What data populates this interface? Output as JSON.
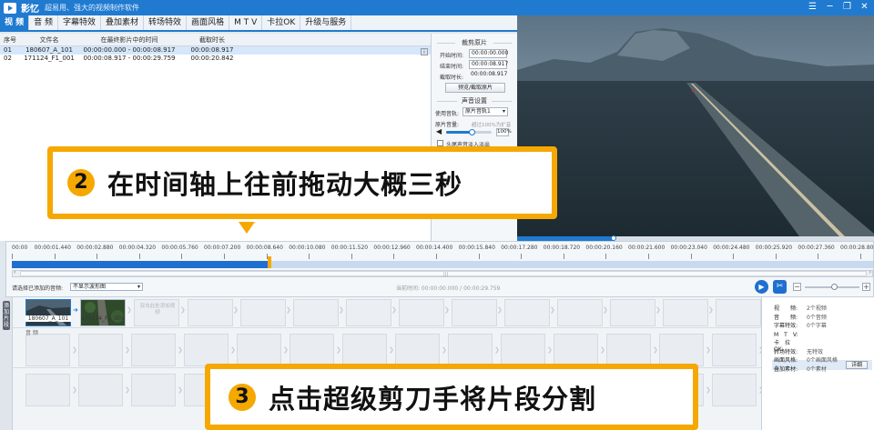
{
  "titlebar": {
    "app_name": "影忆",
    "slogan": "超易用、强大的视频制作软件",
    "buttons": [
      "☰",
      "─",
      "❐",
      "✕"
    ]
  },
  "menu": {
    "items": [
      "视 频",
      "音 频",
      "字幕特效",
      "叠加素材",
      "转场特效",
      "画面风格",
      "M T V",
      "卡拉OK",
      "升级与服务"
    ],
    "active_index": 0
  },
  "clips_table": {
    "headers": [
      "序号",
      "文件名",
      "在最终影片中的时间",
      "截取时长"
    ],
    "rows": [
      {
        "no": "01",
        "file": "180607_A_101",
        "time": "00:00:00.000 - 00:00:08.917",
        "duration": "00:00:08.917"
      },
      {
        "no": "02",
        "file": "171124_F1_001",
        "time": "00:00:08.917 - 00:00:29.759",
        "duration": "00:00:20.842"
      }
    ],
    "info_icon": "i"
  },
  "settings": {
    "cut_title": "裁剪原片",
    "start_label": "开始时间:",
    "start_value": "00:00:00.000",
    "end_label": "结束时间:",
    "end_value": "00:00:08.917",
    "duration_label": "截取时长:",
    "duration_value": "00:00:08.917",
    "preview_button": "预览/截取原片",
    "audio_title": "声音设置",
    "track_label": "使用音轨:",
    "track_value": "原片音轨1",
    "volume_label": "原片音量:",
    "volume_hint": "超过100%为扩音",
    "volume_value": "100%",
    "volume_level": 0.55,
    "fade_label": "头尾声音淡入淡出"
  },
  "preview": {
    "progress": 0.27
  },
  "timeline": {
    "ticks": [
      "00:00",
      "00:00:01.440",
      "00:00:02.880",
      "00:00:04.320",
      "00:00:05.760",
      "00:00:07.200",
      "00:00:08.640",
      "00:00:10.080",
      "00:00:11.520",
      "00:00:12.960",
      "00:00:14.400",
      "00:00:15.840",
      "00:00:17.280",
      "00:00:18.720",
      "00:00:20.160",
      "00:00:21.600",
      "00:00:23.040",
      "00:00:24.480",
      "00:00:25.920",
      "00:00:27.360",
      "00:00:28.800"
    ],
    "playhead_seconds": 8.917,
    "total_seconds": 29.759,
    "select_label": "请选择已添加的音频:",
    "select_value": "不显示波形图",
    "time_readout": "当前时间: 00:00:00.000 / 00:00:29.759",
    "play_icon": "▶",
    "scissors_icon": "✂",
    "zoom_minus": "−",
    "zoom_plus": "+",
    "scroll_grip": "|||"
  },
  "tracks": {
    "side_tab": "添加片段",
    "clip1_name": "180607_A_101",
    "clip2_name": "171124_F1_001",
    "placeholder_text": "双击此处添加视频",
    "audio_label": "音 频"
  },
  "stats": {
    "rows": [
      {
        "key": "视　　频:",
        "val": "2个视频"
      },
      {
        "key": "音　　频:",
        "val": "0个音频"
      },
      {
        "key": "字幕特效:",
        "val": "0个字幕"
      },
      {
        "key": "M　T　V:",
        "val": ""
      },
      {
        "key": "卡　拉　OK:",
        "val": ""
      },
      {
        "key": "转场特效:",
        "val": "无特效"
      },
      {
        "key": "画面风格:",
        "val": "0个画面风格"
      },
      {
        "key": "叠加素材:",
        "val": "0个素材"
      }
    ],
    "detail_button": "详细"
  },
  "callouts": {
    "step2_num": "2",
    "step2_text": "在时间轴上往前拖动大概三秒",
    "step3_num": "3",
    "step3_text": "点击超级剪刀手将片段分割"
  },
  "colors": {
    "accent": "#1f7ad0",
    "callout": "#f5a800"
  }
}
